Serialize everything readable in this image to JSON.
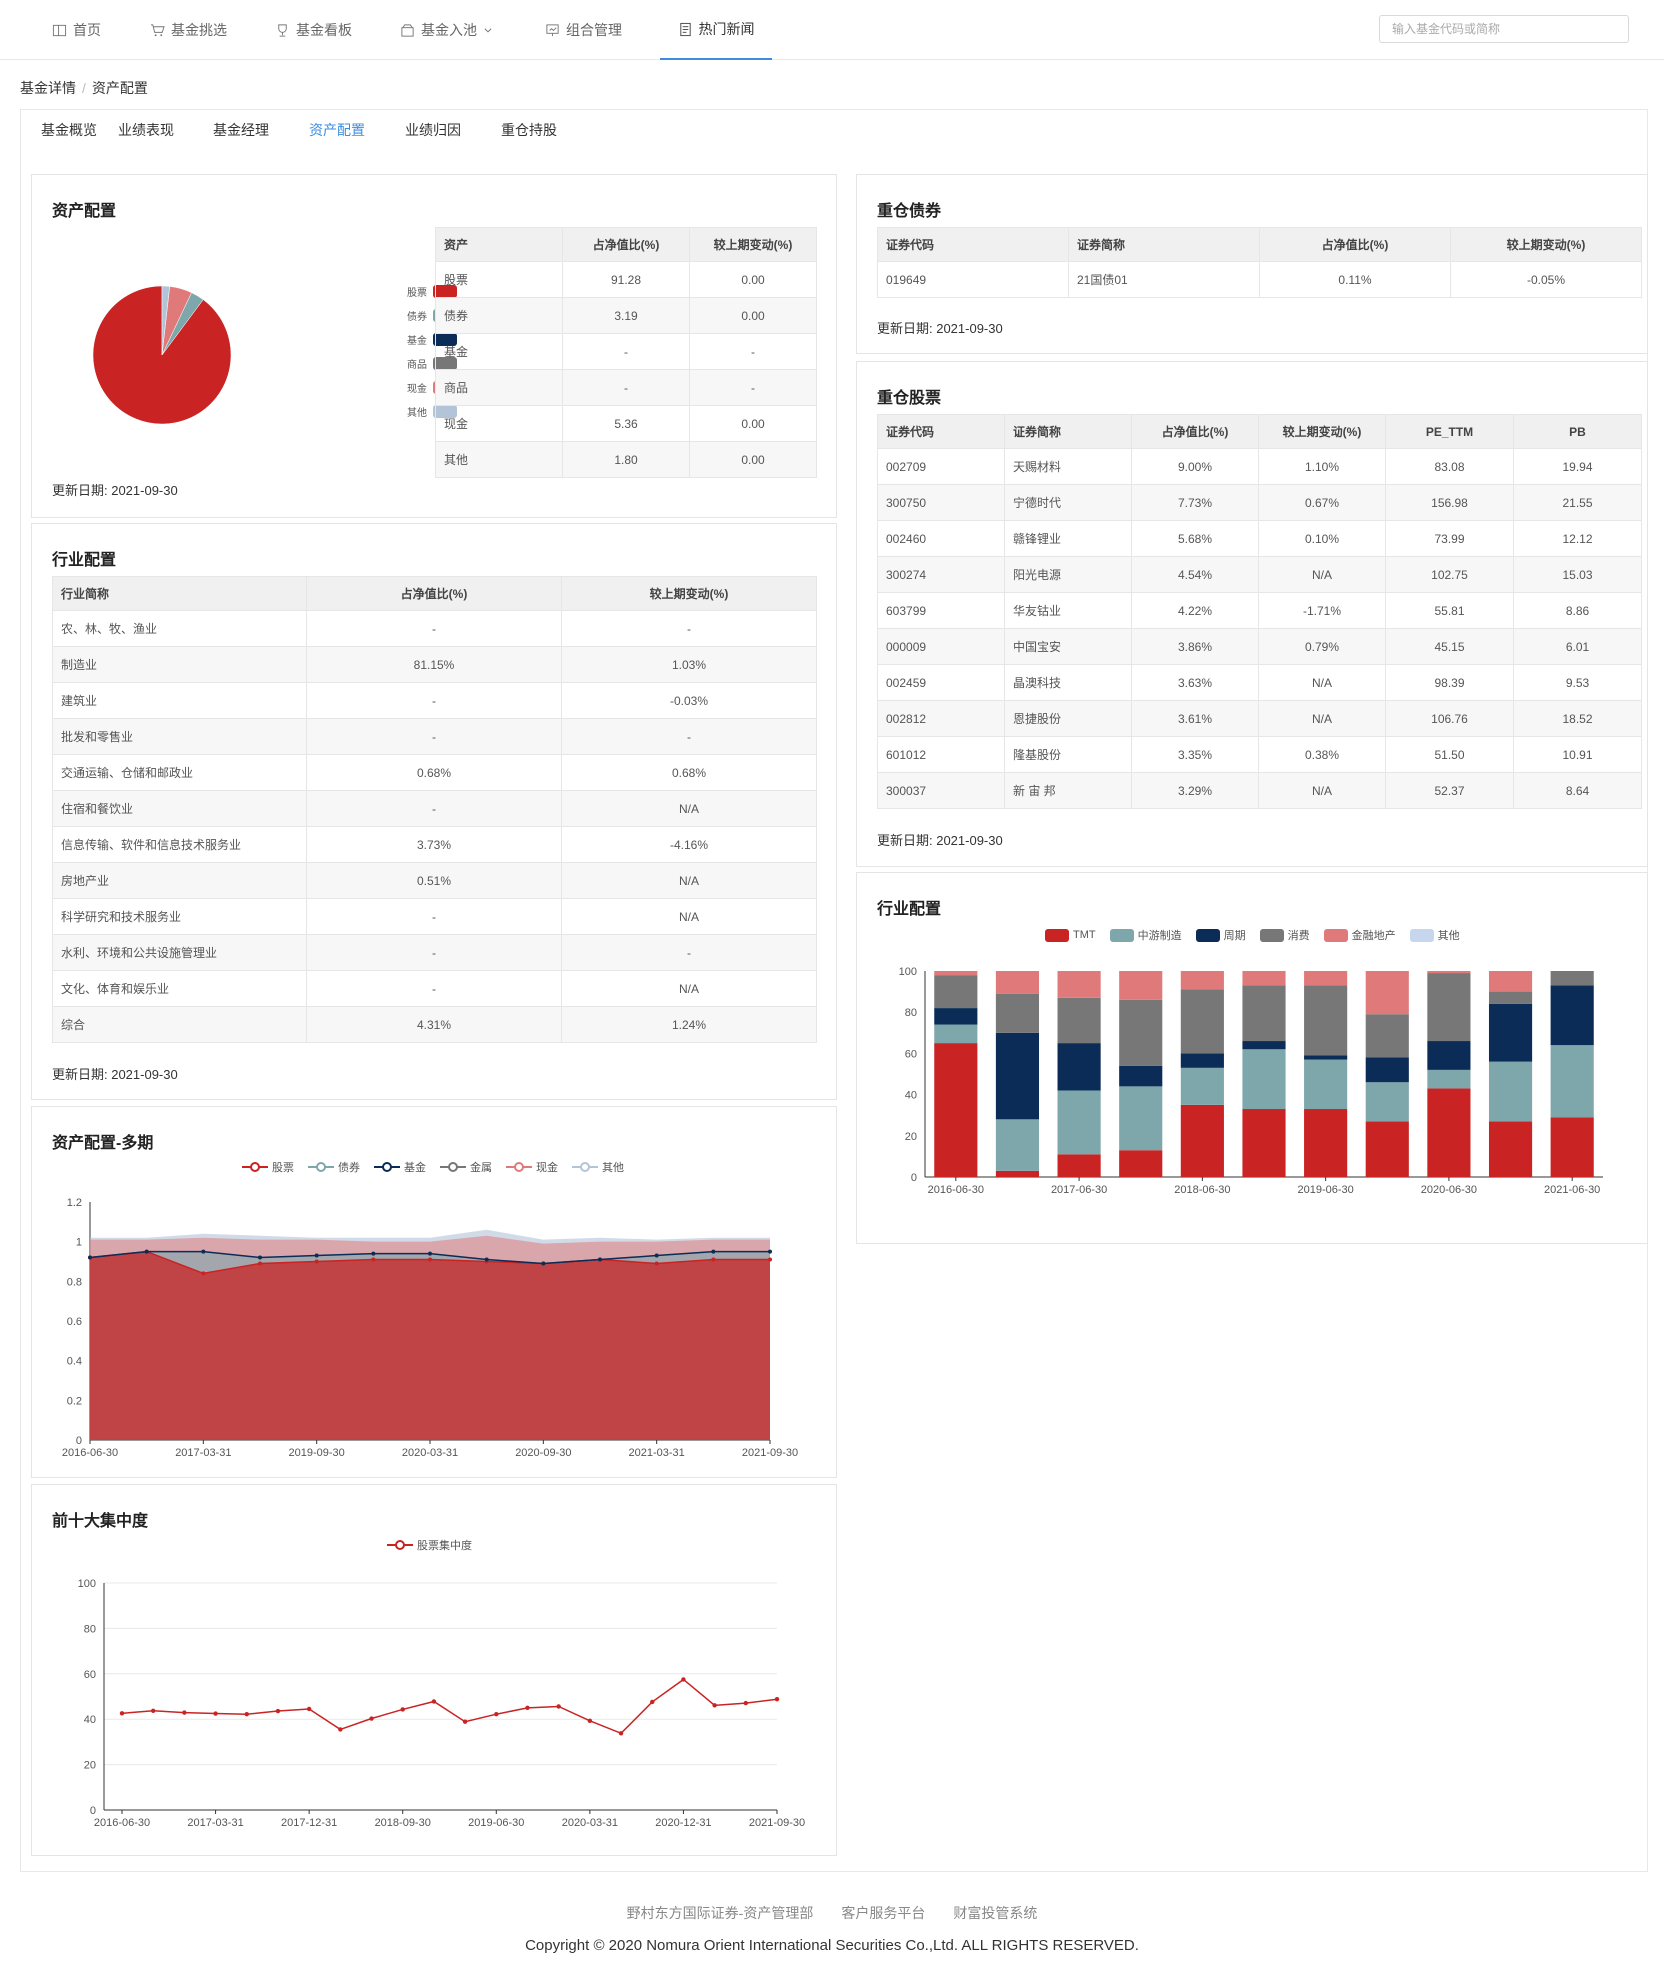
{
  "nav": {
    "items": [
      {
        "label": "首页",
        "icon": "home-icon"
      },
      {
        "label": "基金挑选",
        "icon": "cart-icon"
      },
      {
        "label": "基金看板",
        "icon": "trophy-icon"
      },
      {
        "label": "基金入池",
        "icon": "box-icon"
      },
      {
        "label": "组合管理",
        "icon": "presentation-icon"
      },
      {
        "label": "热门新闻",
        "icon": "news-icon"
      }
    ],
    "active": "热门新闻",
    "search_placeholder": "输入基金代码或简称"
  },
  "breadcrumb": {
    "parent": "基金详情",
    "current": "资产配置"
  },
  "tabs": {
    "items": [
      "基金概览",
      "业绩表现",
      "基金经理",
      "资产配置",
      "业绩归因",
      "重仓持股"
    ],
    "active": "资产配置"
  },
  "asset_alloc": {
    "title": "资产配置",
    "update": "更新日期: 2021-09-30",
    "headers": [
      "资产",
      "占净值比(%)",
      "较上期变动(%)"
    ],
    "rows": [
      [
        "股票",
        "91.28",
        "0.00"
      ],
      [
        "债券",
        "3.19",
        "0.00"
      ],
      [
        "基金",
        "-",
        "-"
      ],
      [
        "商品",
        "-",
        "-"
      ],
      [
        "现金",
        "5.36",
        "0.00"
      ],
      [
        "其他",
        "1.80",
        "0.00"
      ]
    ],
    "legend": [
      {
        "name": "股票",
        "color": "#c92323"
      },
      {
        "name": "债券",
        "color": "#7ea7ab"
      },
      {
        "name": "基金",
        "color": "#0a2c57"
      },
      {
        "name": "商品",
        "color": "#777777"
      },
      {
        "name": "现金",
        "color": "#e07a7a"
      },
      {
        "name": "其他",
        "color": "#b3c3d8"
      }
    ]
  },
  "industry_alloc": {
    "title": "行业配置",
    "update": "更新日期: 2021-09-30",
    "headers": [
      "行业简称",
      "占净值比(%)",
      "较上期变动(%)"
    ],
    "rows": [
      [
        "农、林、牧、渔业",
        "-",
        "-"
      ],
      [
        "制造业",
        "81.15%",
        "1.03%"
      ],
      [
        "建筑业",
        "-",
        "-0.03%"
      ],
      [
        "批发和零售业",
        "-",
        "-"
      ],
      [
        "交通运输、仓储和邮政业",
        "0.68%",
        "0.68%"
      ],
      [
        "住宿和餐饮业",
        "-",
        "N/A"
      ],
      [
        "信息传输、软件和信息技术服务业",
        "3.73%",
        "-4.16%"
      ],
      [
        "房地产业",
        "0.51%",
        "N/A"
      ],
      [
        "科学研究和技术服务业",
        "-",
        "N/A"
      ],
      [
        "水利、环境和公共设施管理业",
        "-",
        "-"
      ],
      [
        "文化、体育和娱乐业",
        "-",
        "N/A"
      ],
      [
        "综合",
        "4.31%",
        "1.24%"
      ]
    ]
  },
  "bond_holdings": {
    "title": "重仓债券",
    "update": "更新日期: 2021-09-30",
    "headers": [
      "证券代码",
      "证券简称",
      "占净值比(%)",
      "较上期变动(%)"
    ],
    "rows": [
      [
        "019649",
        "21国债01",
        "0.11%",
        "-0.05%"
      ]
    ]
  },
  "stock_holdings": {
    "title": "重仓股票",
    "update": "更新日期: 2021-09-30",
    "headers": [
      "证券代码",
      "证券简称",
      "占净值比(%)",
      "较上期变动(%)",
      "PE_TTM",
      "PB"
    ],
    "rows": [
      [
        "002709",
        "天赐材料",
        "9.00%",
        "1.10%",
        "83.08",
        "19.94"
      ],
      [
        "300750",
        "宁德时代",
        "7.73%",
        "0.67%",
        "156.98",
        "21.55"
      ],
      [
        "002460",
        "赣锋锂业",
        "5.68%",
        "0.10%",
        "73.99",
        "12.12"
      ],
      [
        "300274",
        "阳光电源",
        "4.54%",
        "N/A",
        "102.75",
        "15.03"
      ],
      [
        "603799",
        "华友钴业",
        "4.22%",
        "-1.71%",
        "55.81",
        "8.86"
      ],
      [
        "000009",
        "中国宝安",
        "3.86%",
        "0.79%",
        "45.15",
        "6.01"
      ],
      [
        "002459",
        "晶澳科技",
        "3.63%",
        "N/A",
        "98.39",
        "9.53"
      ],
      [
        "002812",
        "恩捷股份",
        "3.61%",
        "N/A",
        "106.76",
        "18.52"
      ],
      [
        "601012",
        "隆基股份",
        "3.35%",
        "0.38%",
        "51.50",
        "10.91"
      ],
      [
        "300037",
        "新 宙 邦",
        "3.29%",
        "N/A",
        "52.37",
        "8.64"
      ]
    ]
  },
  "multi_period": {
    "title": "资产配置-多期"
  },
  "top10": {
    "title": "前十大集中度"
  },
  "industry_chart": {
    "title": "行业配置"
  },
  "chart_data": [
    {
      "type": "pie",
      "values": [
        91.28,
        3.19,
        0,
        0,
        5.36,
        1.8
      ],
      "categories": [
        "股票",
        "债券",
        "基金",
        "商品",
        "现金",
        "其他"
      ]
    },
    {
      "type": "area",
      "series": [
        {
          "name": "股票",
          "color": "#c92323",
          "values": [
            0.92,
            0.95,
            0.84,
            0.89,
            0.9,
            0.91,
            0.91,
            0.9,
            0.89,
            0.91,
            0.89,
            0.91,
            0.91
          ]
        },
        {
          "name": "债券",
          "color": "#7ea7ab",
          "values": [
            0.92,
            0.95,
            0.95,
            0.92,
            0.93,
            0.94,
            0.94,
            0.91,
            0.89,
            0.91,
            0.93,
            0.95,
            0.95
          ]
        },
        {
          "name": "基金",
          "color": "#0a2c57",
          "values": [
            0.92,
            0.95,
            0.95,
            0.92,
            0.93,
            0.94,
            0.94,
            0.91,
            0.89,
            0.91,
            0.93,
            0.95,
            0.95
          ]
        },
        {
          "name": "金属",
          "color": "#777777",
          "values": [
            0.92,
            0.95,
            0.95,
            0.92,
            0.93,
            0.94,
            0.94,
            0.91,
            0.89,
            0.91,
            0.93,
            0.95,
            0.95
          ]
        },
        {
          "name": "现金",
          "color": "#e07a7a",
          "values": [
            1.01,
            1.01,
            1.02,
            1.01,
            1.01,
            1.0,
            1.0,
            1.03,
            0.99,
            1.0,
            1.0,
            1.01,
            1.01
          ]
        },
        {
          "name": "其他",
          "color": "#b3c3d8",
          "values": [
            1.02,
            1.02,
            1.04,
            1.03,
            1.02,
            1.02,
            1.02,
            1.06,
            1.01,
            1.02,
            1.01,
            1.02,
            1.02
          ]
        }
      ],
      "x_ticks": [
        "2016-06-30",
        "2017-03-31",
        "2019-09-30",
        "2020-03-31",
        "2020-09-30",
        "2021-03-31",
        "2021-09-30"
      ],
      "ylim": [
        0,
        1.2
      ],
      "y_ticks": [
        0,
        0.2,
        0.4,
        0.6,
        0.8,
        1,
        1.2
      ]
    },
    {
      "type": "line",
      "series": [
        {
          "name": "股票集中度",
          "color": "#c92323",
          "values": [
            42.6,
            43.7,
            42.9,
            42.5,
            42.2,
            43.6,
            44.5,
            35.5,
            40.3,
            44.3,
            47.8,
            38.9,
            42.2,
            45,
            45.6,
            39.3,
            33.8,
            47.6,
            57.5,
            46.1,
            47.1,
            48.8
          ]
        }
      ],
      "x_ticks": [
        "2016-06-30",
        "2017-03-31",
        "2017-12-31",
        "2018-09-30",
        "2019-06-30",
        "2020-03-31",
        "2020-12-31",
        "2021-09-30"
      ],
      "ylim": [
        0,
        100
      ],
      "y_ticks": [
        0,
        20,
        40,
        60,
        80,
        100
      ]
    },
    {
      "type": "bar",
      "stacked": true,
      "series": [
        {
          "name": "TMT",
          "color": "#c92323",
          "values": [
            65,
            3,
            11,
            13,
            35,
            33,
            33,
            27,
            43,
            27,
            29
          ]
        },
        {
          "name": "中游制造",
          "color": "#7ea7ab",
          "values": [
            9,
            25,
            31,
            31,
            18,
            29,
            24,
            19,
            9,
            29,
            35
          ]
        },
        {
          "name": "周期",
          "color": "#0a2c57",
          "values": [
            8,
            42,
            23,
            10,
            7,
            4,
            2,
            12,
            14,
            28,
            29
          ]
        },
        {
          "name": "消费",
          "color": "#777777",
          "values": [
            16,
            19,
            22,
            32,
            31,
            27,
            34,
            21,
            33,
            6,
            7
          ]
        },
        {
          "name": "金融地产",
          "color": "#e07a7a",
          "values": [
            2,
            11,
            13,
            14,
            9,
            7,
            7,
            21,
            1,
            10,
            0
          ]
        },
        {
          "name": "其他",
          "color": "#c6d6ef",
          "values": [
            0,
            0,
            0,
            0,
            0,
            0,
            0,
            0,
            0,
            0,
            0
          ]
        }
      ],
      "x_ticks": [
        "2016-06-30",
        "2017-06-30",
        "2018-06-30",
        "2019-06-30",
        "2020-06-30",
        "2021-06-30"
      ],
      "ylim": [
        0,
        100
      ],
      "y_ticks": [
        0,
        20,
        40,
        60,
        80,
        100
      ]
    }
  ],
  "footer": {
    "links": [
      "野村东方国际证券-资产管理部",
      "客户服务平台",
      "财富投管系统"
    ],
    "copyright": "Copyright © 2020 Nomura Orient International Securities Co.,Ltd. ALL RIGHTS RESERVED."
  }
}
